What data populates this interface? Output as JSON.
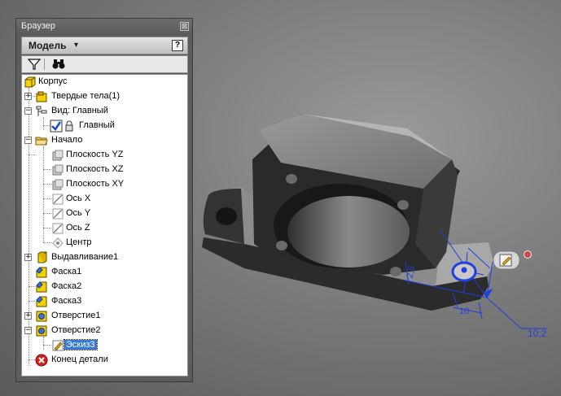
{
  "browser": {
    "title": "Браузер",
    "close_glyph": "⊠",
    "mode_label": "Модель",
    "mode_arrow": "▾",
    "help_glyph": "?",
    "toolbar": {
      "filter_icon": "filter-icon",
      "find_icon": "binoculars-icon"
    },
    "tree": [
      {
        "label": "Корпус",
        "icon": "part-icon",
        "level": 0
      },
      {
        "label": "Твердые тела(1)",
        "icon": "solid-bodies-icon",
        "level": 1,
        "expander": "+"
      },
      {
        "label": "Вид: Главный",
        "icon": "view-rep-icon",
        "level": 1,
        "expander": "−"
      },
      {
        "label": "Главный",
        "icon": "view-check-lock-icon",
        "level": 2
      },
      {
        "label": "Начало",
        "icon": "origin-folder-icon",
        "level": 1,
        "expander": "−"
      },
      {
        "label": "Плоскость YZ",
        "icon": "plane-icon",
        "level": 2
      },
      {
        "label": "Плоскость XZ",
        "icon": "plane-icon",
        "level": 2
      },
      {
        "label": "Плоскость XY",
        "icon": "plane-icon",
        "level": 2
      },
      {
        "label": "Ось X",
        "icon": "axis-icon",
        "level": 2
      },
      {
        "label": "Ось Y",
        "icon": "axis-icon",
        "level": 2
      },
      {
        "label": "Ось Z",
        "icon": "axis-icon",
        "level": 2
      },
      {
        "label": "Центр",
        "icon": "center-point-icon",
        "level": 2
      },
      {
        "label": "Выдавливание1",
        "icon": "extrude-icon",
        "level": 1,
        "expander": "+"
      },
      {
        "label": "Фаска1",
        "icon": "chamfer-icon",
        "level": 1
      },
      {
        "label": "Фаска2",
        "icon": "chamfer-icon",
        "level": 1
      },
      {
        "label": "Фаска3",
        "icon": "chamfer-icon",
        "level": 1
      },
      {
        "label": "Отверстие1",
        "icon": "hole-icon",
        "level": 1,
        "expander": "+"
      },
      {
        "label": "Отверстие2",
        "icon": "hole-icon",
        "level": 1,
        "expander": "−"
      },
      {
        "label": "Эскиз3",
        "icon": "sketch-icon",
        "level": 2,
        "selected": true
      },
      {
        "label": "Конец детали",
        "icon": "end-of-part-icon",
        "level": 1
      }
    ]
  },
  "viewport": {
    "dimensions": [
      {
        "label": "2,5"
      },
      {
        "label": "10"
      },
      {
        "label": "10,2"
      }
    ],
    "sketch_color": "#1f3fe0",
    "part_color": "#2a2a2a",
    "edit_icon": "sketch-edit-icon",
    "close_icon": "close-icon"
  }
}
